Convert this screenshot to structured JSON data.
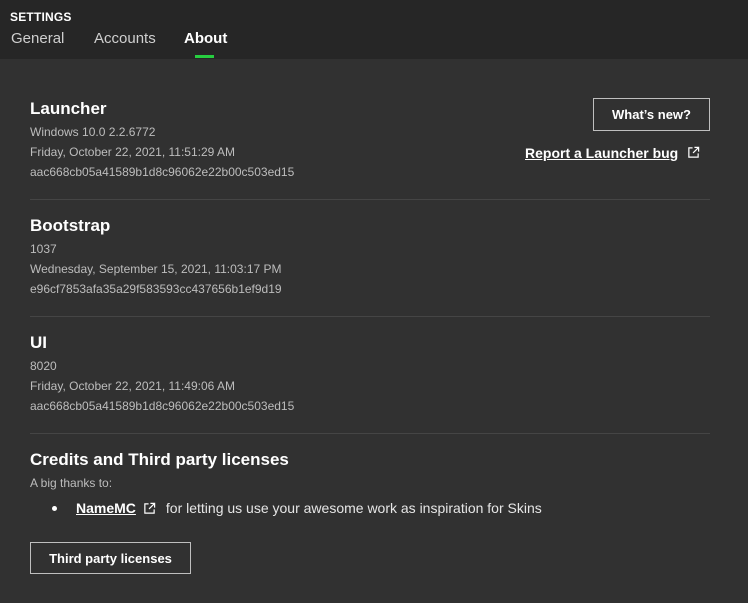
{
  "header": {
    "title": "SETTINGS",
    "tabs": [
      {
        "label": "General",
        "active": false
      },
      {
        "label": "Accounts",
        "active": false
      },
      {
        "label": "About",
        "active": true
      }
    ]
  },
  "launcher": {
    "title": "Launcher",
    "version": "Windows 10.0 2.2.6772",
    "date": "Friday, October 22, 2021, 11:51:29 AM",
    "hash": "aac668cb05a41589b1d8c96062e22b00c503ed15",
    "whats_new_label": "What’s new?",
    "report_bug_label": "Report a Launcher bug"
  },
  "bootstrap": {
    "title": "Bootstrap",
    "version": "1037",
    "date": "Wednesday, September 15, 2021, 11:03:17 PM",
    "hash": "e96cf7853afa35a29f583593cc437656b1ef9d19"
  },
  "ui": {
    "title": "UI",
    "version": "8020",
    "date": "Friday, October 22, 2021, 11:49:06 AM",
    "hash": "aac668cb05a41589b1d8c96062e22b00c503ed15"
  },
  "credits": {
    "title": "Credits and Third party licenses",
    "subtitle": "A big thanks to:",
    "items": [
      {
        "link": "NameMC",
        "text": "for letting us use your awesome work as inspiration for Skins"
      }
    ],
    "licenses_button": "Third party licenses"
  },
  "colors": {
    "background": "#313131",
    "header_bg": "#262626",
    "accent": "#27ce40"
  },
  "icons": {
    "external_link": "external-link-icon"
  }
}
